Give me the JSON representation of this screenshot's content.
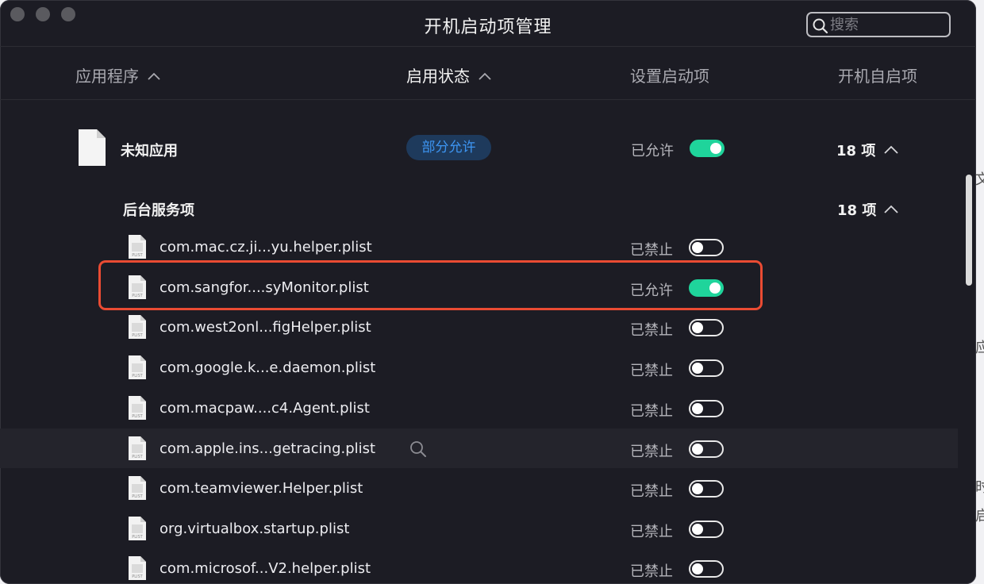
{
  "window": {
    "title": "开机启动项管理"
  },
  "search": {
    "placeholder": "搜索"
  },
  "columns": {
    "app": "应用程序",
    "status": "启用状态",
    "setting": "设置启动项",
    "boot": "开机自启项"
  },
  "app_group": {
    "name": "未知应用",
    "badge": "部分允许",
    "status": "已允许",
    "toggle_on": true,
    "count": "18 项"
  },
  "section": {
    "title": "后台服务项",
    "count": "18 项"
  },
  "items": [
    {
      "name": "com.mac.cz.ji...yu.helper.plist",
      "status": "已禁止",
      "on": false
    },
    {
      "name": "com.sangfor....syMonitor.plist",
      "status": "已允许",
      "on": true
    },
    {
      "name": "com.west2onl...figHelper.plist",
      "status": "已禁止",
      "on": false
    },
    {
      "name": "com.google.k...e.daemon.plist",
      "status": "已禁止",
      "on": false
    },
    {
      "name": "com.macpaw....c4.Agent.plist",
      "status": "已禁止",
      "on": false
    },
    {
      "name": "com.apple.ins...getracing.plist",
      "status": "已禁止",
      "on": false
    },
    {
      "name": "com.teamviewer.Helper.plist",
      "status": "已禁止",
      "on": false
    },
    {
      "name": "org.virtualbox.startup.plist",
      "status": "已禁止",
      "on": false
    },
    {
      "name": "com.microsof...V2.helper.plist",
      "status": "已禁止",
      "on": false
    }
  ],
  "edge_fragments": [
    "文",
    "应",
    "时",
    "启"
  ],
  "colors": {
    "toggle_on": "#1fd49b",
    "badge_text": "#3d95f2",
    "highlight": "#ea4b33"
  }
}
